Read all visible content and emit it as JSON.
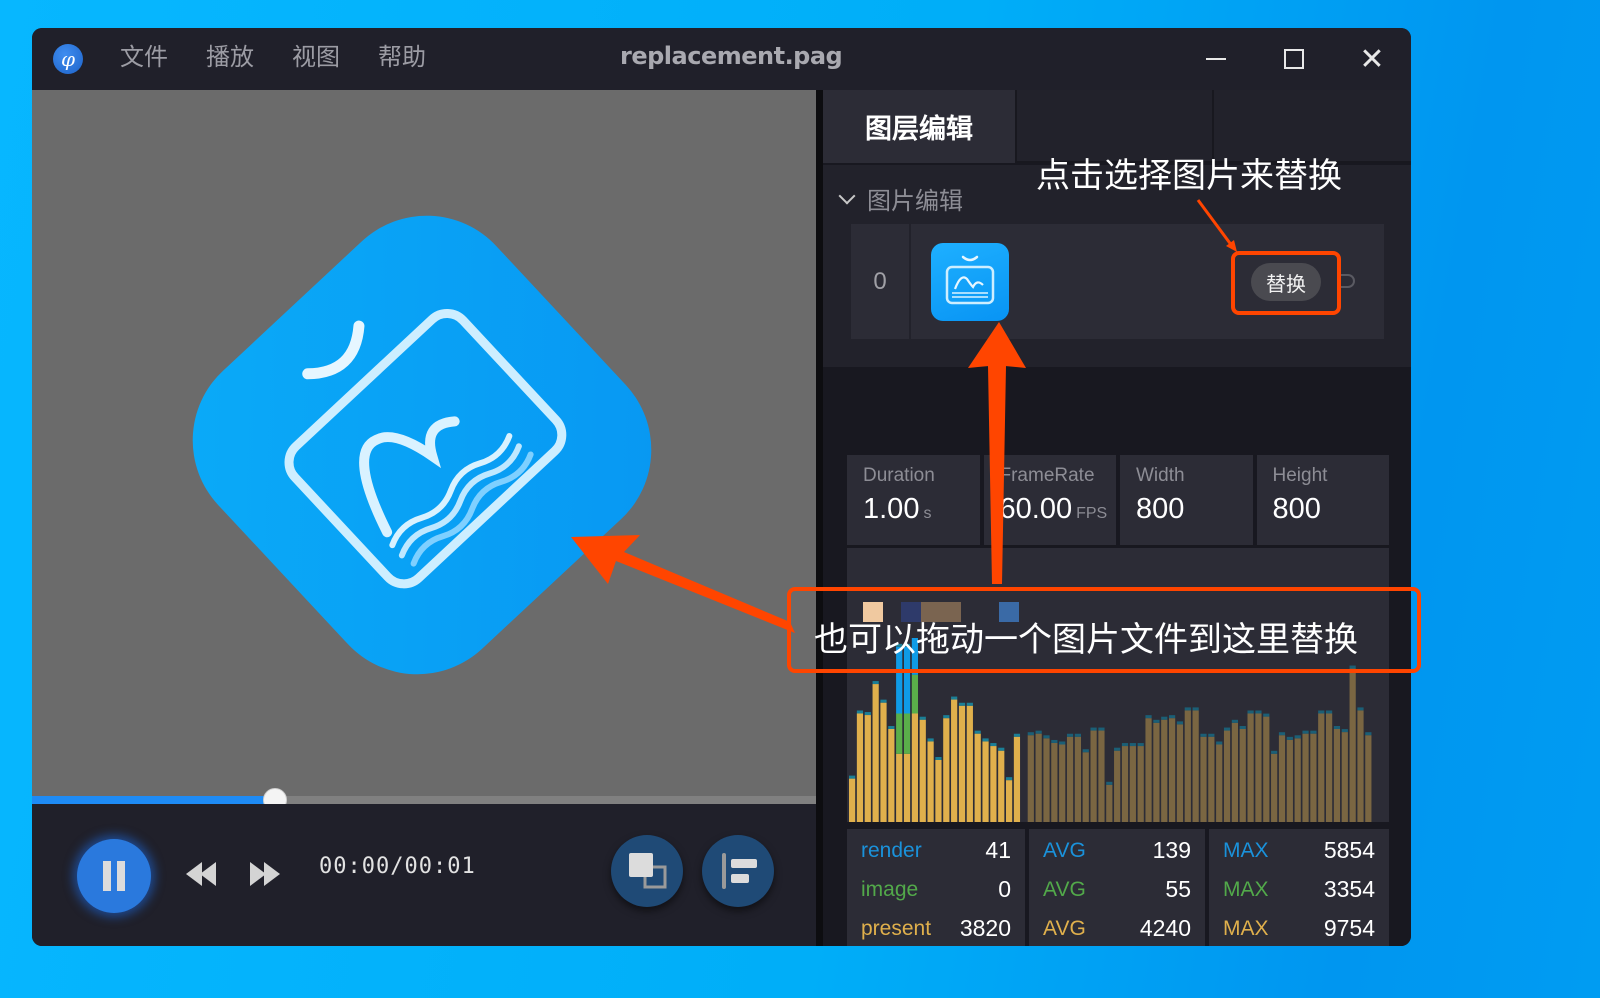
{
  "window": {
    "title": "replacement.pag",
    "app_logo_glyph": "φ",
    "menu": [
      "文件",
      "播放",
      "视图",
      "帮助"
    ],
    "controls": {
      "minimize": "minimize-icon",
      "maximize": "maximize-icon",
      "close_glyph": "✕"
    }
  },
  "player": {
    "progress_fraction": 0.31,
    "timecode": "00:00/00:01",
    "state": "playing",
    "buttons": [
      "pause",
      "rewind",
      "fast-forward",
      "layers",
      "align-left"
    ]
  },
  "panel": {
    "tabs": [
      {
        "label": "图层编辑",
        "active": true
      },
      {
        "label": ""
      },
      {
        "label": ""
      }
    ],
    "section": {
      "title": "图片编辑",
      "expanded": true,
      "items": [
        {
          "index": "0",
          "replace_label": "替换"
        }
      ]
    },
    "stats": [
      {
        "label": "Duration",
        "value": "1.00",
        "unit": "s"
      },
      {
        "label": "FrameRate",
        "value": "60.00",
        "unit": "FPS"
      },
      {
        "label": "Width",
        "value": "800",
        "unit": ""
      },
      {
        "label": "Height",
        "value": "800",
        "unit": ""
      }
    ],
    "legend_colors": [
      "#f0c9a0",
      "#2e3a6a",
      "#7a6450",
      "#7a6450",
      "#3a6aa6"
    ],
    "perf": {
      "rows": [
        {
          "name": "render",
          "value": "41",
          "avg": "139",
          "max": "5854",
          "color": "#1a92db"
        },
        {
          "name": "image",
          "value": "0",
          "avg": "55",
          "max": "3354",
          "color": "#52a94a"
        },
        {
          "name": "present",
          "value": "3820",
          "avg": "4240",
          "max": "9754",
          "color": "#e0b04c"
        }
      ],
      "avg_label": "AVG",
      "max_label": "MAX"
    }
  },
  "chart_data": {
    "type": "bar",
    "title": "",
    "xlabel": "",
    "ylabel": "",
    "series_names": [
      "present",
      "image",
      "render"
    ],
    "colors": {
      "present": "#e0b04c",
      "present_dim": "#7a6642",
      "image": "#5aae4a",
      "render": "#0f9be6"
    },
    "active_frames": 20,
    "present": [
      28,
      70,
      69,
      89,
      77,
      60,
      44,
      44,
      70,
      66,
      52,
      40,
      67,
      79,
      75,
      75,
      57,
      52,
      49,
      46,
      27,
      55
    ],
    "image": [
      0,
      0,
      0,
      0,
      0,
      0,
      26,
      26,
      25,
      0,
      0,
      0,
      0,
      0,
      0,
      0,
      0,
      0,
      0,
      0,
      0,
      0
    ],
    "render": [
      0,
      0,
      0,
      0,
      0,
      0,
      43,
      43,
      43,
      0,
      0,
      0,
      0,
      0,
      0,
      0,
      0,
      0,
      0,
      0,
      0,
      0
    ],
    "dim_values": [
      56,
      57,
      54,
      51,
      50,
      55,
      55,
      45,
      59,
      59,
      24,
      46,
      49,
      49,
      49,
      67,
      64,
      66,
      67,
      63,
      72,
      72,
      55,
      55,
      50,
      59,
      64,
      60,
      70,
      70,
      68,
      44,
      56,
      53,
      54,
      57,
      57,
      70,
      70,
      60,
      58,
      99,
      72,
      56
    ]
  },
  "annotations": {
    "click_hint": "点击选择图片来替换",
    "drag_hint": "也可以拖动一个图片文件到这里替换"
  }
}
